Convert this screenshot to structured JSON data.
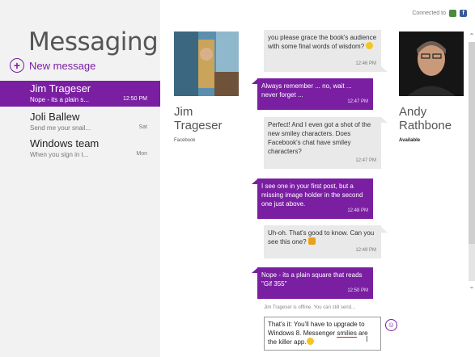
{
  "app": {
    "title": "Messaging"
  },
  "new_message": {
    "label": "New message"
  },
  "conversations": [
    {
      "name": "Jim Trageser",
      "preview": "Nope - its a plain s...",
      "time": "12:50 PM",
      "active": true
    },
    {
      "name": "Joli Ballew",
      "preview": "Send me your snail...",
      "time": "Sat",
      "active": false
    },
    {
      "name": "Windows team",
      "preview": "When you sign in t...",
      "time": "Mon",
      "active": false
    }
  ],
  "connected": {
    "label": "Connected to",
    "icons": [
      "people-icon",
      "facebook-icon"
    ]
  },
  "contact_left": {
    "name_line1": "Jim",
    "name_line2": "Trageser",
    "network": "Facebook"
  },
  "contact_right": {
    "name_line1": "Andy",
    "name_line2": "Rathbone",
    "status": "Available"
  },
  "messages": [
    {
      "from": "other",
      "text": "you please grace the book's audience with some final words of wisdom?",
      "time": "12:46 PM"
    },
    {
      "from": "me",
      "text": "Always remember ... no, wait ... never forget ...",
      "time": "12:47 PM"
    },
    {
      "from": "other",
      "text": "Perfect! And I even got a shot of the new smiley characters. Does Facebook's chat have smiley characters?",
      "time": "12:47 PM"
    },
    {
      "from": "me",
      "text": "I see one in your first post, but a missing image holder in the second one just above.",
      "time": "12:48 PM"
    },
    {
      "from": "other",
      "text": "Uh-oh. That's good to know. Can you see this one?",
      "time": "12:49 PM"
    },
    {
      "from": "me",
      "text": "Nope - its a plain square that reads \"Gif 355\"",
      "time": "12:50 PM"
    }
  ],
  "status_line": "Jim Trageser is offline. You can still send...",
  "compose": {
    "text_a": "That's it: You'll have to upgrade to Windows 8. Messenger ",
    "text_misspelled": "smilies",
    "text_b": " are the killer app."
  },
  "colors": {
    "accent": "#7a1fa2",
    "left_pane": "#f2f2f2",
    "incoming_bubble": "#e9e9e9"
  }
}
